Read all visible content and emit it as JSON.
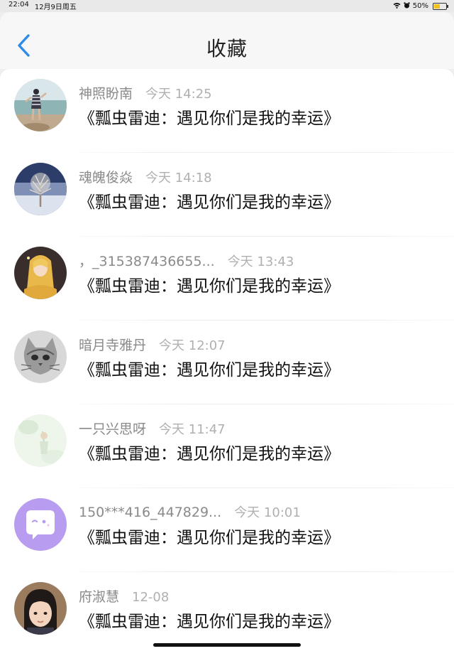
{
  "status_bar": {
    "time": "22:04",
    "date": "12月9日周五",
    "battery": "50%",
    "battery_level": 0.5
  },
  "header": {
    "title": "收藏",
    "back_icon": "chevron-left-icon",
    "accent_color": "#2e8ce6"
  },
  "items": [
    {
      "name": "神照盼南",
      "time": "今天 14:25",
      "content": "《瓢虫雷迪：遇见你们是我的幸运》",
      "avatar": "photo-girl-by-sea"
    },
    {
      "name": "魂魄俊焱",
      "time": "今天 14:18",
      "content": "《瓢虫雷迪：遇见你们是我的幸运》",
      "avatar": "photo-snowy-tree"
    },
    {
      "name": "，_315387436655...",
      "time": "今天 13:43",
      "content": "《瓢虫雷迪：遇见你们是我的幸运》",
      "avatar": "photo-blonde-anime-girl"
    },
    {
      "name": "暗月寺雅丹",
      "time": "今天 12:07",
      "content": "《瓢虫雷迪：遇见你们是我的幸运》",
      "avatar": "photo-cat-sketch"
    },
    {
      "name": "一只兴思呀",
      "time": "今天 11:47",
      "content": "《瓢虫雷迪：遇见你们是我的幸运》",
      "avatar": "photo-pale-green"
    },
    {
      "name": "150***416_447829...",
      "time": "今天 10:01",
      "content": "《瓢虫雷迪：遇见你们是我的幸运》",
      "avatar": "chat-bubble-default-avatar"
    },
    {
      "name": "府淑慧",
      "time": "12-08",
      "content": "《瓢虫雷迪：遇见你们是我的幸运》",
      "avatar": "photo-child-portrait"
    }
  ]
}
